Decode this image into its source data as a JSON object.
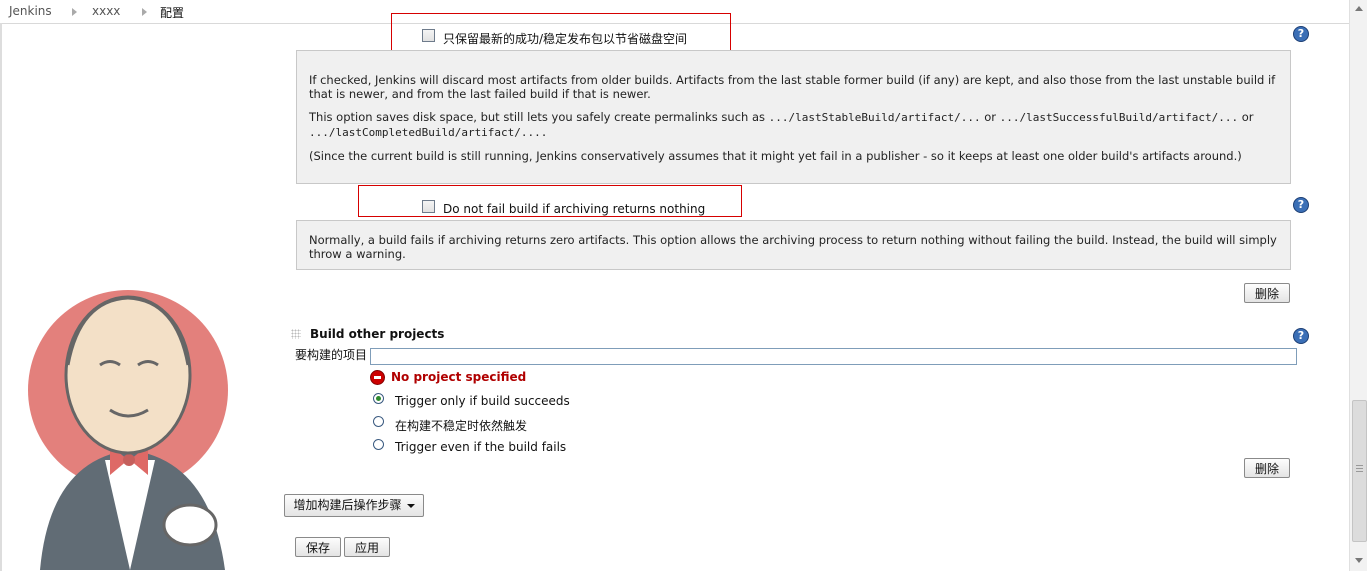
{
  "breadcrumb": {
    "items": [
      "Jenkins",
      "xxxx",
      "配置"
    ]
  },
  "archive_options": {
    "latest_only_label": "只保留最新的成功/稳定发布包以节省磁盘空间",
    "latest_only_checked": false,
    "latest_only_help": {
      "p1": "If checked, Jenkins will discard most artifacts from older builds. Artifacts from the last stable former build (if any) are kept, and also those from the last unstable build if that is newer, and from the last failed build if that is newer.",
      "p2_a": "This option saves disk space, but still lets you safely create permalinks such as",
      "p2_code1": ".../lastStableBuild/artifact/...",
      "p2_or1": "or",
      "p2_code2": ".../lastSuccessfulBuild/artifact/...",
      "p2_or2": "or",
      "p2_code3": ".../lastCompletedBuild/artifact/....",
      "p3": "(Since the current build is still running, Jenkins conservatively assumes that it might yet fail in a publisher - so it keeps at least one older build's artifacts around.)"
    },
    "allow_empty_label": "Do not fail build if archiving returns nothing",
    "allow_empty_checked": false,
    "allow_empty_help": "Normally, a build fails if archiving returns zero artifacts. This option allows the archiving process to return nothing without failing the build. Instead, the build will simply throw a warning.",
    "delete_label": "删除"
  },
  "build_other_projects": {
    "title": "Build other projects",
    "projects_label": "要构建的项目",
    "projects_value": "",
    "error_text": "No project specified",
    "radio_options": [
      {
        "label": "Trigger only if build succeeds",
        "checked": true
      },
      {
        "label": "在构建不稳定时依然触发",
        "checked": false
      },
      {
        "label": "Trigger even if the build fails",
        "checked": false
      }
    ],
    "delete_label": "删除"
  },
  "footer": {
    "add_post_build_label": "增加构建后操作步骤",
    "save_label": "保存",
    "apply_label": "应用"
  },
  "help_icon_text": "?"
}
